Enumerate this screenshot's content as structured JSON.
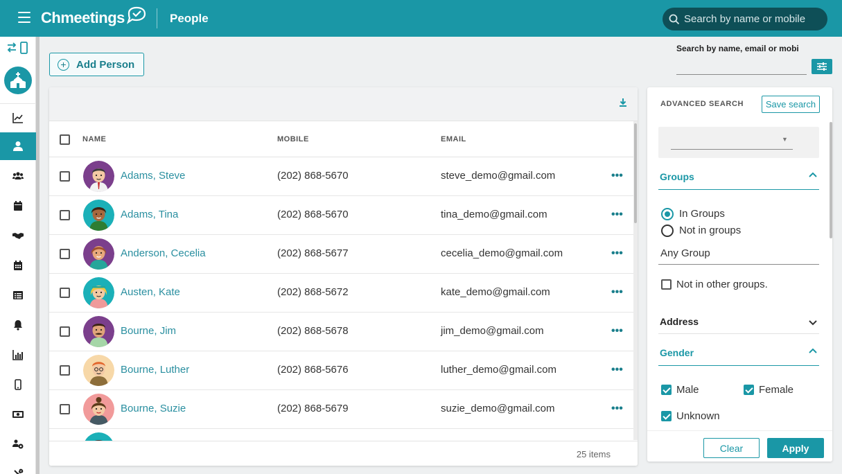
{
  "header": {
    "app_name": "Chmeetings",
    "page_title": "People",
    "search_placeholder": "Search by name or mobile"
  },
  "sidebar": {
    "items": [
      {
        "icon": "dashboard-chart-icon",
        "active": false
      },
      {
        "icon": "person-icon",
        "active": true
      },
      {
        "icon": "groups-icon",
        "active": false
      },
      {
        "icon": "calendar-icon",
        "active": false
      },
      {
        "icon": "handshake-icon",
        "active": false
      },
      {
        "icon": "calendar-grid-icon",
        "active": false
      },
      {
        "icon": "list-form-icon",
        "active": false
      },
      {
        "icon": "bell-icon",
        "active": false
      },
      {
        "icon": "bar-chart-icon",
        "active": false
      },
      {
        "icon": "mobile-icon",
        "active": false
      },
      {
        "icon": "money-icon",
        "active": false
      },
      {
        "icon": "people-settings-icon",
        "active": false
      },
      {
        "icon": "tools-icon",
        "active": false
      }
    ]
  },
  "toolbar": {
    "add_person_label": "Add Person"
  },
  "search_box": {
    "label": "Search by name, email or mobi"
  },
  "table": {
    "columns": [
      "NAME",
      "MOBILE",
      "EMAIL"
    ],
    "rows": [
      {
        "name": "Adams, Steve",
        "mobile": "(202) 868-5670",
        "email": "steve_demo@gmail.com",
        "more": "•••"
      },
      {
        "name": "Adams, Tina",
        "mobile": "(202) 868-5670",
        "email": "tina_demo@gmail.com",
        "more": "•••"
      },
      {
        "name": "Anderson, Cecelia",
        "mobile": "(202) 868-5677",
        "email": "cecelia_demo@gmail.com",
        "more": "•••"
      },
      {
        "name": "Austen, Kate",
        "mobile": "(202) 868-5672",
        "email": "kate_demo@gmail.com",
        "more": "•••"
      },
      {
        "name": "Bourne, Jim",
        "mobile": "(202) 868-5678",
        "email": "jim_demo@gmail.com",
        "more": "•••"
      },
      {
        "name": "Bourne, Luther",
        "mobile": "(202) 868-5676",
        "email": "luther_demo@gmail.com",
        "more": "•••"
      },
      {
        "name": "Bourne, Suzie",
        "mobile": "(202) 868-5679",
        "email": "suzie_demo@gmail.com",
        "more": "•••"
      }
    ],
    "items_count": "25 items"
  },
  "advanced_search": {
    "title": "ADVANCED SEARCH",
    "save_label": "Save search",
    "groups": {
      "title": "Groups",
      "option_in": "In Groups",
      "option_not_in": "Not in groups",
      "selected": "In Groups",
      "any_group": "Any Group",
      "not_in_other": "Not in other groups.",
      "not_in_other_checked": false
    },
    "address": {
      "title": "Address"
    },
    "gender": {
      "title": "Gender",
      "male": "Male",
      "female": "Female",
      "unknown": "Unknown",
      "male_checked": true,
      "female_checked": true,
      "unknown_checked": true
    },
    "clear_label": "Clear",
    "apply_label": "Apply"
  },
  "colors": {
    "brand": "#1a97a6",
    "brand_dark": "#0e4f57",
    "link": "#2a8fa0"
  }
}
